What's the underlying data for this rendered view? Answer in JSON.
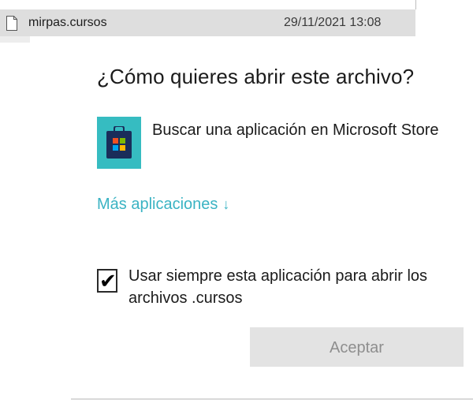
{
  "explorer_row": {
    "file_name": "mirpas.cursos",
    "modified": "29/11/2021 13:08"
  },
  "dialog": {
    "title": "¿Cómo quieres abrir este archivo?",
    "store_option": {
      "label": "Buscar una aplicación en Microsoft Store",
      "icon": "microsoft-store-icon"
    },
    "more_apps": {
      "label": "Más aplicaciones",
      "arrow": "↓"
    },
    "always_use": {
      "checked": true,
      "label": "Usar siempre esta aplicación para abrir los archivos .cursos"
    },
    "accept_label": "Aceptar"
  },
  "colors": {
    "accent": "#3ab3c3",
    "store_tile": "#36bcc1",
    "button_bg": "#e3e3e3",
    "button_text": "#8e8e8e"
  }
}
